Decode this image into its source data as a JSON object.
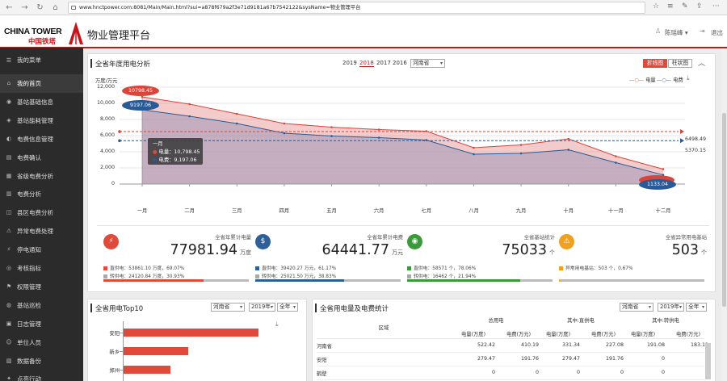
{
  "browser": {
    "url": "www.hnctpower.com:8081/Main/Main.html?sui=a878f679a2f3e71d9181a67b7542122&sysName=物业管理平台"
  },
  "header": {
    "logo_en": "CHINA TOWER",
    "logo_cn": "中国铁塔",
    "title": "物业管理平台",
    "user": "陈瑶峰",
    "logout": "退出"
  },
  "sidebar": {
    "menu_title": "我的菜单",
    "items": [
      "我的首页",
      "基站基础信息",
      "基站能耗管理",
      "电费信息管理",
      "电费确认",
      "省级电费分析",
      "电费分析",
      "县区电费分析",
      "异常电费处理",
      "停电通知",
      "考核指标",
      "权限管理",
      "基站巡检",
      "日志管理",
      "单位人员",
      "数据备份",
      "点亮行动"
    ],
    "active_index": 0
  },
  "main_panel": {
    "title": "全省年度用电分析",
    "years": [
      "2019",
      "2018",
      "2017",
      "2016"
    ],
    "selected_year": "2018",
    "province": "河南省",
    "view_buttons": [
      "折线图",
      "柱状图"
    ],
    "colors": {
      "electricity": "#d9453a",
      "fee": "#2a5a96"
    }
  },
  "chart_data": {
    "type": "area",
    "ylabel": "万度/万元",
    "ylim": [
      0,
      12000
    ],
    "yticks": [
      "0",
      "2,000",
      "4,000",
      "6,000",
      "8,000",
      "10,000",
      "12,000"
    ],
    "categories": [
      "一月",
      "二月",
      "三月",
      "四月",
      "五月",
      "六月",
      "七月",
      "八月",
      "九月",
      "十月",
      "十一月",
      "十二月"
    ],
    "series": [
      {
        "name": "电量",
        "values": [
          10798.45,
          9900,
          8700,
          7500,
          7050,
          6750,
          6550,
          4500,
          4850,
          5600,
          3450,
          1850
        ]
      },
      {
        "name": "电费",
        "values": [
          9197.06,
          8400,
          7500,
          6300,
          5950,
          5750,
          5450,
          3700,
          3800,
          4250,
          2650,
          1133.04
        ]
      }
    ],
    "legend_position": "top-right",
    "label_points": {
      "first_elec": "10798.45",
      "first_fee": "9197.06",
      "last_fee": "1133.04"
    },
    "avg_lines": {
      "electricity": 6498.49,
      "fee": 5370.15
    },
    "avg_labels": [
      "6498.49",
      "5370.15"
    ],
    "tooltip": {
      "title": "一月",
      "line1": "电量：10,798.45",
      "line2": "电费：9,197.06"
    }
  },
  "cards": [
    {
      "label": "全省年累计电量",
      "value": "77981.94",
      "unit": "万度",
      "color": "#e04a3b",
      "icon": "bolt-icon",
      "line1": "直供电：53861.10 万度，69.07%",
      "line2": "转供电：24120.84 万度，30.93%",
      "progress": 0.69,
      "c1": "#e04a3b",
      "c2": "#aaaaaa"
    },
    {
      "label": "全省年累计电费",
      "value": "64441.77",
      "unit": "万元",
      "color": "#2e5f99",
      "icon": "money-bag-icon",
      "line1": "直供电：39420.27 万元，61.17%",
      "line2": "转供电：25021.50 万元，38.83%",
      "progress": 0.61,
      "c1": "#2e5f99",
      "c2": "#aaaaaa"
    },
    {
      "label": "全省基站统计",
      "value": "75033",
      "unit": "个",
      "color": "#3a9a3a",
      "icon": "signal-tower-icon",
      "line1": "直供电：58571 个，78.06%",
      "line2": "转供电：16462 个，21.94%",
      "progress": 0.78,
      "c1": "#3a9a3a",
      "c2": "#aaaaaa"
    },
    {
      "label": "全省异常用电基站",
      "value": "503",
      "unit": "个",
      "color": "#f0a020",
      "icon": "warning-icon",
      "line1": "异常用电基站：503 个，0.67%",
      "line2": "",
      "progress": 0.0067,
      "c1": "#f0a020",
      "c2": ""
    }
  ],
  "top10": {
    "title": "全省用电Top10",
    "province": "河南省",
    "year": "2019年",
    "period": "全年",
    "bars": [
      {
        "name": "安阳",
        "value": 1.0
      },
      {
        "name": "新乡",
        "value": 0.48
      },
      {
        "name": "郑州",
        "value": 0.35
      }
    ]
  },
  "stats": {
    "title": "全省用电量及电费统计",
    "province": "河南省",
    "year": "2019年",
    "period": "全年",
    "col_region": "区域",
    "groups": [
      "总用电",
      "其中:直供电",
      "其中:转供电"
    ],
    "sub": [
      "电量(万度)",
      "电费(万元)"
    ],
    "rows": [
      {
        "region": "河南省",
        "v": [
          "522.42",
          "410.19",
          "331.34",
          "227.08",
          "191.08",
          "183.11"
        ]
      },
      {
        "region": "安阳",
        "v": [
          "279.47",
          "191.76",
          "279.47",
          "191.76",
          "0",
          "0"
        ]
      },
      {
        "region": "鹤壁",
        "v": [
          "0",
          "0",
          "0",
          "0",
          "0",
          "0"
        ]
      }
    ]
  }
}
